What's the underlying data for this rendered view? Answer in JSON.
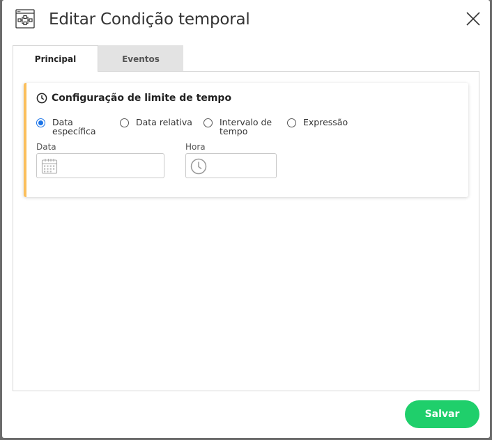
{
  "dialog": {
    "title": "Editar Condição temporal",
    "header_icon": "flow-diagram-icon",
    "close_icon": "close-icon"
  },
  "tabs": [
    {
      "label": "Principal",
      "active": true
    },
    {
      "label": "Eventos",
      "active": false
    }
  ],
  "card": {
    "title": "Configuração de limite de tempo",
    "title_icon": "clock-icon",
    "accent_color": "#fbbf5c",
    "radio_options": [
      {
        "label": "Data específica",
        "checked": true
      },
      {
        "label": "Data relativa",
        "checked": false
      },
      {
        "label": "Intervalo de tempo",
        "checked": false
      },
      {
        "label": "Expressão",
        "checked": false
      }
    ],
    "fields": {
      "date": {
        "label": "Data",
        "value": "",
        "icon": "calendar-icon"
      },
      "time": {
        "label": "Hora",
        "value": "",
        "icon": "clock-icon"
      }
    }
  },
  "footer": {
    "save_label": "Salvar",
    "save_color": "#1fcf6b"
  }
}
